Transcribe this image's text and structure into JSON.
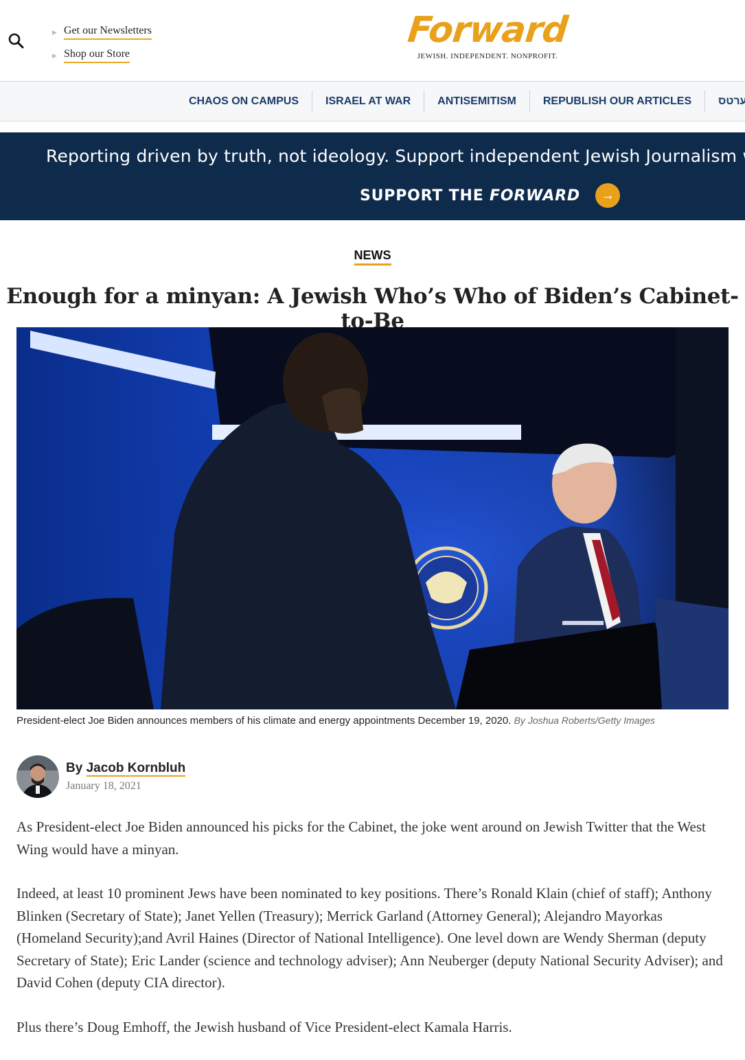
{
  "header": {
    "links": [
      "Get our Newsletters",
      "Shop our Store"
    ],
    "logo_text": "Forward",
    "tagline": "JEWISH. INDEPENDENT. NONPROFIT."
  },
  "nav": {
    "items": [
      "CHAOS ON CAMPUS",
      "ISRAEL AT WAR",
      "ANTISEMITISM",
      "REPUBLISH OUR ARTICLES",
      "פֿאָרווערטס"
    ]
  },
  "promo": {
    "text": "Reporting driven by truth, not ideology. Support independent Jewish Journalism with a gift today.",
    "button_prefix": "SUPPORT THE ",
    "button_emphasis": "FORWARD",
    "arrow": "→"
  },
  "article": {
    "section": "NEWS",
    "headline": "Enough for a minyan: A Jewish Who’s Who of Biden’s Cabinet-to-Be",
    "caption": "President-elect Joe Biden announces members of his climate and energy appointments December 19, 2020.",
    "caption_credit": "By Joshua Roberts/Getty Images",
    "byline_prefix": "By ",
    "author": "Jacob Kornbluh",
    "date": "January 18, 2021",
    "paragraphs": [
      "As President-elect Joe Biden announced his picks for the Cabinet, the joke went around on Jewish Twitter that the West Wing would have a minyan.",
      "Indeed, at least 10 prominent Jews have been nominated to key positions. There’s Ronald Klain (chief of staff); Anthony Blinken (Secretary of State); Janet Yellen (Treasury); Merrick Garland (Attorney General); Alejandro Mayorkas (Homeland Security);and Avril Haines (Director of National Intelligence). One level down are Wendy Sherman (deputy Secretary of State); Eric Lander (science and technology adviser); Ann Neuberger (deputy National Security Adviser); and David Cohen (deputy CIA director).",
      "Plus there’s Doug Emhoff, the Jewish husband of Vice President-elect Kamala Harris."
    ]
  },
  "colors": {
    "brand_gold": "#e9a11b",
    "navy": "#0e2b4c",
    "nav_text": "#1b3c6a"
  }
}
